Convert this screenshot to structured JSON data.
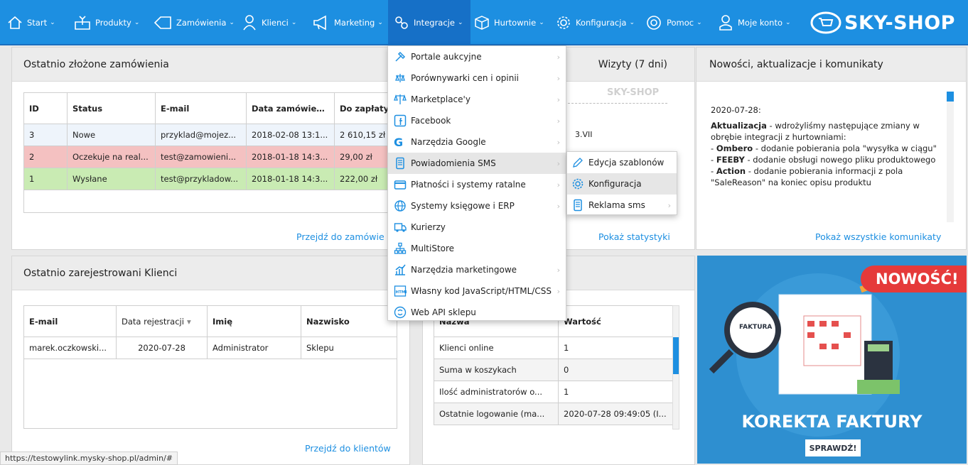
{
  "nav": {
    "items": [
      {
        "label": "Start",
        "icon": "home-icon"
      },
      {
        "label": "Produkty",
        "icon": "box-icon"
      },
      {
        "label": "Zamówienia",
        "icon": "tag-icon"
      },
      {
        "label": "Klienci",
        "icon": "user-icon"
      },
      {
        "label": "Marketing",
        "icon": "megaphone-icon"
      },
      {
        "label": "Integracje",
        "icon": "integration-icon"
      },
      {
        "label": "Hurtownie",
        "icon": "cube-icon"
      },
      {
        "label": "Konfiguracja",
        "icon": "gear-icon"
      },
      {
        "label": "Pomoc",
        "icon": "help-icon"
      },
      {
        "label": "Moje konto",
        "icon": "account-icon"
      }
    ],
    "logo": "SKY-SHOP",
    "accent": "#1d8fe1"
  },
  "orders": {
    "title": "Ostatnio złożone zamówienia",
    "columns": [
      "ID",
      "Status",
      "E-mail",
      "Data zamówieni...",
      "Do zapłaty"
    ],
    "rows": [
      {
        "id": "3",
        "status": "Nowe",
        "email": "przyklad@mojez...",
        "date": "2018-02-08 13:1...",
        "amount": "2 610,15 zł",
        "color": "#eef4fb"
      },
      {
        "id": "2",
        "status": "Oczekuje na real...",
        "email": "test@zamowieni...",
        "date": "2018-01-18 14:3...",
        "amount": "29,00 zł",
        "color": "#f4c1c1"
      },
      {
        "id": "1",
        "status": "Wysłane",
        "email": "test@przykladow...",
        "date": "2018-01-18 14:3...",
        "amount": "222,00 zł",
        "color": "#c9ebb3"
      }
    ],
    "link": "Przejdź do zamówie"
  },
  "visits": {
    "title": "Wizyty (7 dni)",
    "watermark": "SKY-SHOP",
    "partial_label": "3.VII",
    "link": "Pokaż statystyki"
  },
  "news": {
    "title": "Nowości, aktualizacje i komunikaty",
    "date": "2020-07-28:",
    "lines": [
      {
        "b": "Aktualizacja",
        "t": " - wdrożyliśmy następujące zmiany w obrębie integracji z hurtowniami:"
      },
      {
        "b": "",
        "t": "- "
      },
      {
        "b": "Ombero",
        "t": " - dodanie pobierania pola \"wysyłka w ciągu\""
      },
      {
        "b": "FEEBY",
        "t": " - dodanie obsługi nowego pliku produktowego"
      },
      {
        "b": "Action",
        "t": " - dodanie pobierania informacji z pola \"SaleReason\" na koniec opisu produktu"
      }
    ],
    "link": "Pokaż wszystkie komunikaty"
  },
  "clients": {
    "title": "Ostatnio zarejestrowani Klienci",
    "columns": [
      "E-mail",
      "Data rejestracji",
      "Imię",
      "Nazwisko"
    ],
    "rows": [
      {
        "email": "marek.oczkowski...",
        "date": "2020-07-28",
        "first": "Administrator",
        "last": "Sklepu"
      }
    ],
    "link": "Przejdź do klientów"
  },
  "stats": {
    "columns": [
      "Nazwa",
      "Wartość"
    ],
    "rows": [
      {
        "name": "Klienci online",
        "value": "1"
      },
      {
        "name": "Suma w koszykach",
        "value": "0"
      },
      {
        "name": "Ilość administratorów o...",
        "value": "1"
      },
      {
        "name": "Ostatnie logowanie (ma...",
        "value": "2020-07-28 09:49:05 (I..."
      }
    ]
  },
  "banner": {
    "badge": "NOWOŚĆ!",
    "doc_label": "FAKTURA",
    "title": "KOREKTA FAKTURY",
    "cta": "SPRAWDŹ!"
  },
  "dropdown": {
    "items": [
      {
        "label": "Portale aukcyjne",
        "icon": "hammer-icon",
        "sub": true
      },
      {
        "label": "Porównywarki cen i opinii",
        "icon": "comparison-icon",
        "sub": true
      },
      {
        "label": "Marketplace'y",
        "icon": "scales-icon",
        "sub": true
      },
      {
        "label": "Facebook",
        "icon": "facebook-icon",
        "sub": true
      },
      {
        "label": "Narzędzia Google",
        "icon": "google-icon",
        "sub": true
      },
      {
        "label": "Powiadomienia SMS",
        "icon": "sms-icon",
        "sub": true
      },
      {
        "label": "Płatności i systemy ratalne",
        "icon": "payment-icon",
        "sub": true
      },
      {
        "label": "Systemy księgowe i ERP",
        "icon": "globe-icon",
        "sub": true
      },
      {
        "label": "Kurierzy",
        "icon": "truck-icon",
        "sub": false
      },
      {
        "label": "MultiStore",
        "icon": "network-icon",
        "sub": false
      },
      {
        "label": "Narzędzia marketingowe",
        "icon": "chart-icon",
        "sub": true
      },
      {
        "label": "Własny kod JavaScript/HTML/CSS",
        "icon": "html-icon",
        "sub": true
      },
      {
        "label": "Web API sklepu",
        "icon": "api-icon",
        "sub": false
      }
    ]
  },
  "submenu": {
    "items": [
      {
        "label": "Edycja szablonów",
        "icon": "edit-icon",
        "sub": false
      },
      {
        "label": "Konfiguracja",
        "icon": "gear-icon",
        "sub": false
      },
      {
        "label": "Reklama sms",
        "icon": "sms-icon",
        "sub": true
      }
    ]
  },
  "statusbar": {
    "url": "https://testowylink.mysky-shop.pl/admin/#"
  }
}
